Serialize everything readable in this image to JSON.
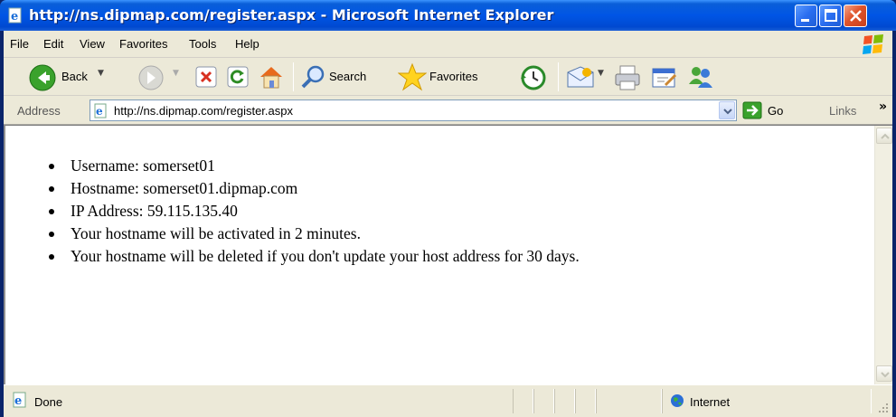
{
  "window": {
    "title": "http://ns.dipmap.com/register.aspx - Microsoft Internet Explorer"
  },
  "menu": [
    "File",
    "Edit",
    "View",
    "Favorites",
    "Tools",
    "Help"
  ],
  "toolbar": {
    "back_label": "Back",
    "search_label": "Search",
    "favorites_label": "Favorites"
  },
  "address": {
    "label": "Address",
    "url": "http://ns.dipmap.com/register.aspx",
    "go_label": "Go",
    "links_label": "Links"
  },
  "content": {
    "items": [
      "Username: somerset01",
      "Hostname: somerset01.dipmap.com",
      "IP Address: 59.115.135.40",
      "Your hostname will be activated in 2 minutes.",
      "Your hostname will be deleted if you don't update your host address for 30 days."
    ]
  },
  "status": {
    "text": "Done",
    "zone": "Internet"
  },
  "colors": {
    "titlebar": "#0055e5",
    "chrome": "#ece9d8",
    "close_button": "#e0532b"
  }
}
